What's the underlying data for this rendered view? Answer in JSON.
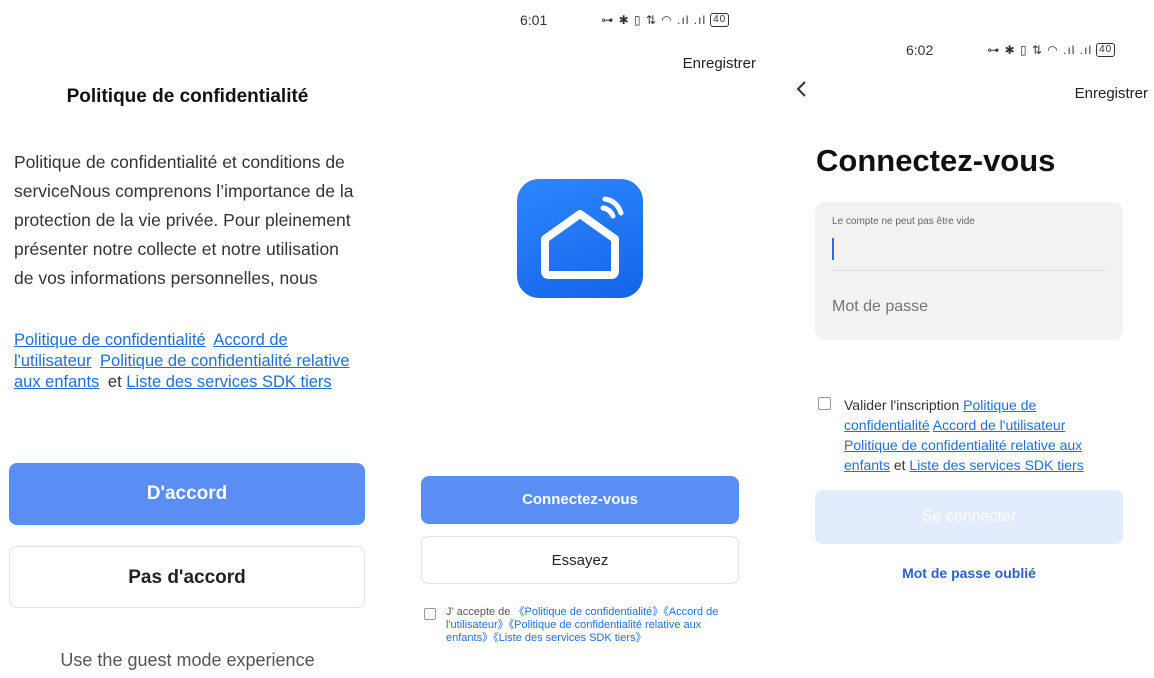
{
  "panel1": {
    "title": "Politique de confidentialité",
    "body": "Politique de confidentialité et conditions de serviceNous comprenons l’importance de la protection de la vie privée. Pour pleinement présenter notre collecte et notre utilisation de vos informations personnelles, nous",
    "link_privacy": "Politique de confidentialité",
    "link_user_agreement": "Accord de l'utilisateur",
    "link_children": "Politique de confidentialité relative aux enfants",
    "and_text": "et",
    "link_sdk": "Liste des services SDK tiers",
    "agree_button": "D'accord",
    "disagree_button": "Pas d'accord",
    "guest_text": "Use the guest mode experience"
  },
  "panel2": {
    "status_time": "6:01",
    "status_icons": "⊶ ✱ ▯ ⇅ ◠ .ıl .ıl",
    "battery": "40",
    "register": "Enregistrer",
    "login_button": "Connectez-vous",
    "try_button": "Essayez",
    "accept_prefix": "J’ accepte de",
    "accept_links": "《Politique de confidentialité》《Accord de l'utilisateur》《Politique de confidentialité relative aux enfants》《Liste des services SDK tiers》"
  },
  "panel3": {
    "status_time": "6:02",
    "status_icons": "⊶ ✱ ▯ ⇅ ◠ .ıl .ıl",
    "battery": "40",
    "register": "Enregistrer",
    "title": "Connectez-vous",
    "account_hint": "Le compte ne peut pas être vide",
    "password_placeholder": "Mot de passe",
    "validate_text": "Valider l'inscription",
    "link_privacy": "Politique de confidentialité",
    "link_user_agreement": "Accord de l'utilisateur",
    "link_children": "Politique de confidentialité relative aux enfants",
    "and_text": "et",
    "link_sdk": "Liste des services SDK tiers",
    "connect_button": "Se connecter",
    "forgot_password": "Mot de passe oublié"
  }
}
